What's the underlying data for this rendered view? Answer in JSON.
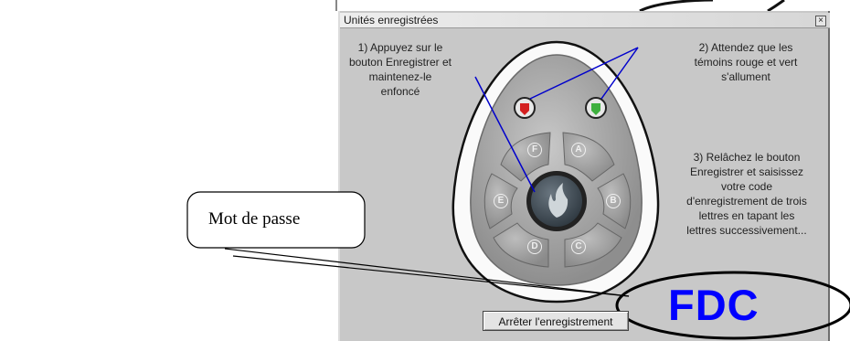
{
  "dialog": {
    "title": "Unités enregistrées",
    "close_symbol": "×"
  },
  "instructions": {
    "step1": [
      "1) Appuyez sur le",
      "bouton Enregistrer et",
      "maintenez-le",
      "enfoncé"
    ],
    "step2": [
      "2) Attendez que les",
      "témoins rouge et vert",
      "s'allument"
    ],
    "step3": [
      "3) Relâchez le bouton",
      "Enregistrer et saisissez",
      "votre code",
      "d'enregistrement de trois",
      "lettres en tapant les",
      "lettres successivement..."
    ]
  },
  "remote": {
    "keys": [
      "F",
      "A",
      "E",
      "B",
      "D",
      "C"
    ],
    "indicator_colors": {
      "red": "#d42020",
      "green": "#3fb03f"
    }
  },
  "stop_button_label": "Arrêter l'enregistrement",
  "code_value": "FDC",
  "callout_label": "Mot de passe",
  "colors": {
    "dialog_bg": "#c8c8c8",
    "code_text": "#0000ff",
    "pointer_lines": "#0000cc"
  }
}
